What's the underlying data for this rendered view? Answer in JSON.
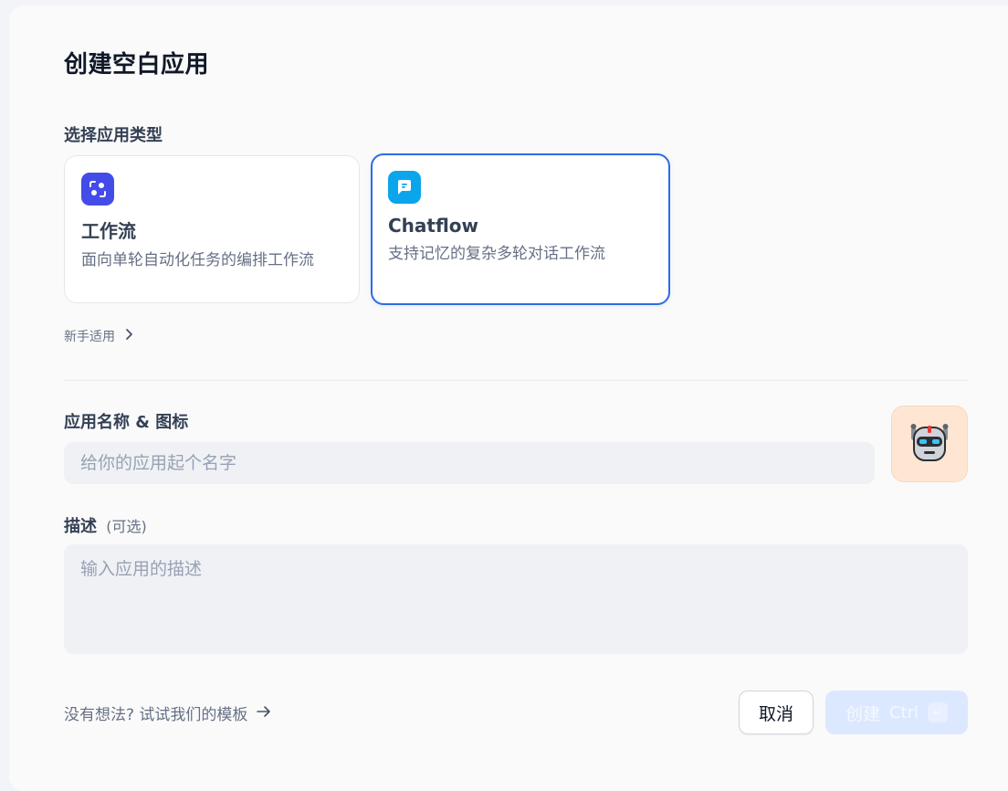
{
  "dialog": {
    "title": "创建空白应用"
  },
  "app_type": {
    "label": "选择应用类型",
    "options": [
      {
        "name": "工作流",
        "description": "面向单轮自动化任务的编排工作流",
        "icon": "workflow-icon",
        "icon_color": "#444ce7",
        "selected": false
      },
      {
        "name": "Chatflow",
        "description": "支持记忆的复杂多轮对话工作流",
        "icon": "chatflow-icon",
        "icon_color": "#0ba5ec",
        "selected": true
      }
    ],
    "beginner_link": "新手适用"
  },
  "name_icon": {
    "label": "应用名称 & 图标",
    "name_placeholder": "给你的应用起个名字",
    "name_value": "",
    "avatar_icon": "robot-icon",
    "avatar_bg": "#ffe6d2"
  },
  "description": {
    "label": "描述",
    "optional": "(可选)",
    "placeholder": "输入应用的描述",
    "value": ""
  },
  "footer": {
    "template_link": "没有想法? 试试我们的模板",
    "cancel_label": "取消",
    "create_label": "创建",
    "shortcut_ctrl": "Ctrl",
    "shortcut_enter": "↵"
  },
  "colors": {
    "accent": "#2d6be6",
    "create_button_disabled": "#dce8ff"
  }
}
